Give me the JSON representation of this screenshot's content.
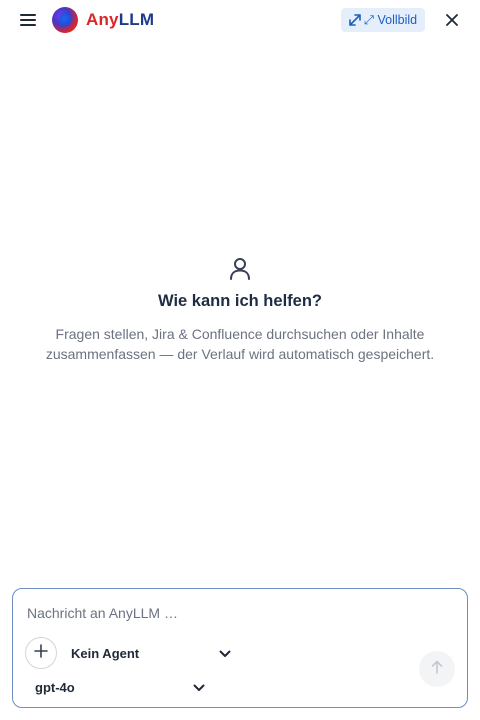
{
  "header": {
    "menu_icon": "hamburger-menu-icon",
    "logo_icon": "anyllm-logo",
    "title_part1": "Any",
    "title_part2": "LLM",
    "fullscreen_icon": "expand-arrows-icon",
    "fullscreen_label": "⤢ Vollbild",
    "close_icon": "close-icon"
  },
  "empty_state": {
    "icon": "user-icon",
    "title": "Wie kann ich helfen?",
    "description": "Fragen stellen, Jira & Confluence durchsuchen oder Inhalte zusammenfassen — der Verlauf wird automatisch gespeichert."
  },
  "composer": {
    "placeholder": "Nachricht an AnyLLM …",
    "value": "",
    "add_icon": "plus-icon",
    "agent_select": {
      "value": "Kein Agent",
      "icon": "chevron-down-icon"
    },
    "model_select": {
      "value": "gpt-4o",
      "icon": "chevron-down-icon"
    },
    "send_icon": "arrow-up-icon"
  },
  "colors": {
    "brand_red": "#dc2626",
    "brand_navy": "#1e3a8a",
    "accent_blue": "#1d5fbf",
    "accent_bg": "#e5effc",
    "composer_border": "#6d8fc4"
  }
}
